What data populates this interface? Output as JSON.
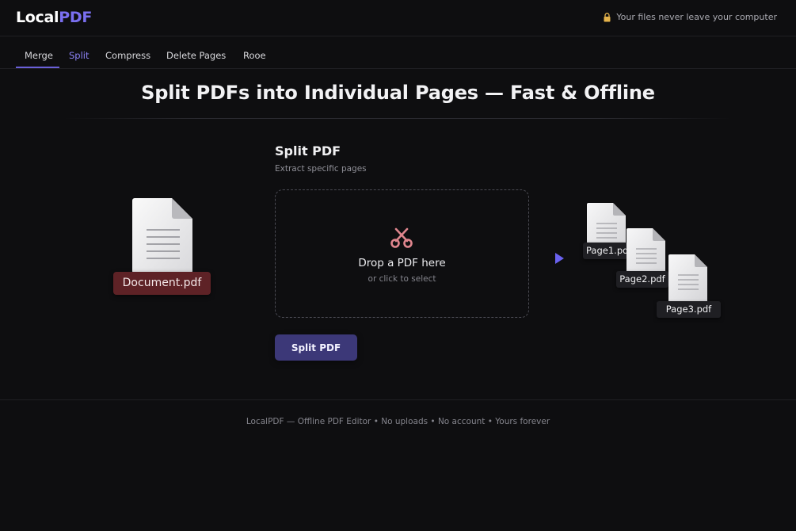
{
  "header": {
    "logo_main": "Local",
    "logo_accent": "PDF",
    "privacy_text": "Your files never leave your computer"
  },
  "tabs": [
    {
      "label": "Merge"
    },
    {
      "label": "Split"
    },
    {
      "label": "Compress"
    },
    {
      "label": "Delete Pages"
    },
    {
      "label": "Rooe"
    }
  ],
  "hero": {
    "title": "Split PDFs into Individual Pages — Fast & Offline"
  },
  "panel": {
    "title": "Split PDF",
    "subtitle": "Extract specific pages",
    "dropzone_title": "Drop a PDF here",
    "dropzone_subtitle": "or click to select",
    "button_label": "Split PDF"
  },
  "illustration": {
    "source_file": "Document.pdf",
    "output_files": [
      "Page1.pdf",
      "Page2.pdf",
      "Page3.pdf"
    ]
  },
  "footer": {
    "text": "LocalPDF — Offline PDF Editor • No uploads • No account • Yours forever"
  },
  "colors": {
    "accent": "#7a6ff0",
    "button": "#3c3878",
    "source_label": "#5e2226",
    "arrow": "#6a62f0"
  },
  "icons": [
    "lock-icon",
    "scissors-icon",
    "document-icon",
    "arrow-right-icon"
  ]
}
